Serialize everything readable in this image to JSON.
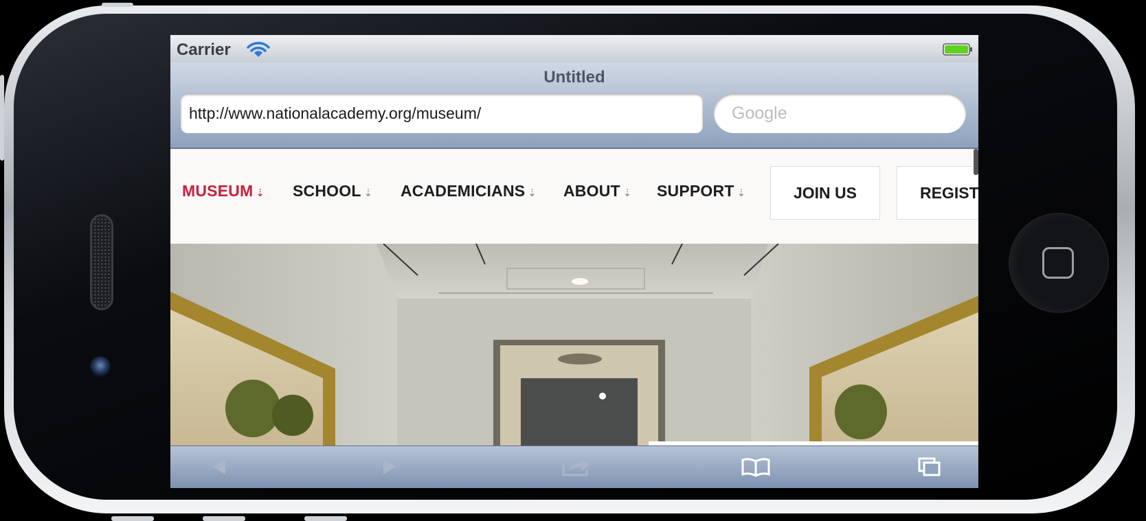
{
  "status_bar": {
    "carrier": "Carrier",
    "wifi_icon": "wifi-icon",
    "battery_icon": "battery-icon",
    "battery_color": "#5fd21f"
  },
  "browser": {
    "page_title": "Untitled",
    "url": "http://www.nationalacademy.org/museum/",
    "search_placeholder": "Google"
  },
  "site_nav": {
    "items": [
      {
        "label": "MUSEUM",
        "active": true
      },
      {
        "label": "SCHOOL",
        "active": false
      },
      {
        "label": "ACADEMICIANS",
        "active": false
      },
      {
        "label": "ABOUT",
        "active": false
      },
      {
        "label": "SUPPORT",
        "active": false
      }
    ],
    "arrow_glyph": "⇣",
    "buttons": {
      "join": "JOIN US",
      "register": "REGIST"
    },
    "active_color": "#c8203c"
  },
  "toolbar": {
    "icons": [
      "back-arrow-icon",
      "forward-arrow-icon",
      "share-icon",
      "bookmarks-icon",
      "tabs-icon"
    ]
  }
}
